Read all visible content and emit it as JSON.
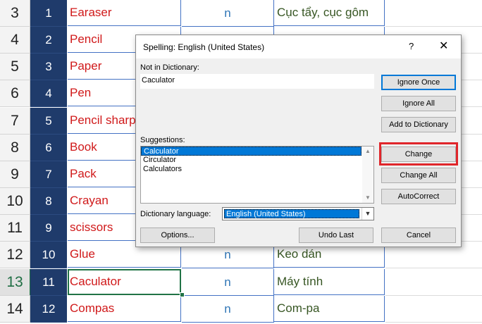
{
  "sheet": {
    "rows": [
      {
        "rn": "3",
        "num": "1",
        "word": "Earaser",
        "type": "n",
        "meaning": "Cục tẩy, cục gôm"
      },
      {
        "rn": "4",
        "num": "2",
        "word": "Pencil",
        "type": "",
        "meaning": ""
      },
      {
        "rn": "5",
        "num": "3",
        "word": "Paper",
        "type": "",
        "meaning": ""
      },
      {
        "rn": "6",
        "num": "4",
        "word": "Pen",
        "type": "",
        "meaning": ""
      },
      {
        "rn": "7",
        "num": "5",
        "word": "Pencil sharp",
        "type": "",
        "meaning": ""
      },
      {
        "rn": "8",
        "num": "6",
        "word": "Book",
        "type": "",
        "meaning": ""
      },
      {
        "rn": "9",
        "num": "7",
        "word": "Pack",
        "type": "",
        "meaning": ""
      },
      {
        "rn": "10",
        "num": "8",
        "word": "Crayan",
        "type": "",
        "meaning": ""
      },
      {
        "rn": "11",
        "num": "9",
        "word": "scissors",
        "type": "",
        "meaning": ""
      },
      {
        "rn": "12",
        "num": "10",
        "word": "Glue",
        "type": "n",
        "meaning": "Keo dán"
      },
      {
        "rn": "13",
        "num": "11",
        "word": "Caculator",
        "type": "n",
        "meaning": "Máy tính"
      },
      {
        "rn": "14",
        "num": "12",
        "word": "Compas",
        "type": "n",
        "meaning": "Com-pa"
      }
    ]
  },
  "dialog": {
    "title": "Spelling: English (United States)",
    "help_icon": "?",
    "close_icon": "✕",
    "not_in_dictionary_label": "Not in Dictionary:",
    "not_in_dictionary_value": "Caculator",
    "suggestions_label": "Suggestions:",
    "suggestions": [
      "Calculator",
      "Circulator",
      "Calculators"
    ],
    "dictionary_language_label": "Dictionary language:",
    "dictionary_language_value": "English (United States)",
    "buttons": {
      "ignore_once": "Ignore Once",
      "ignore_all": "Ignore All",
      "add_to_dictionary": "Add to Dictionary",
      "change": "Change",
      "change_all": "Change All",
      "autocorrect": "AutoCorrect",
      "options": "Options...",
      "undo_last": "Undo Last",
      "cancel": "Cancel"
    },
    "highlight_color": "#e0262b"
  }
}
